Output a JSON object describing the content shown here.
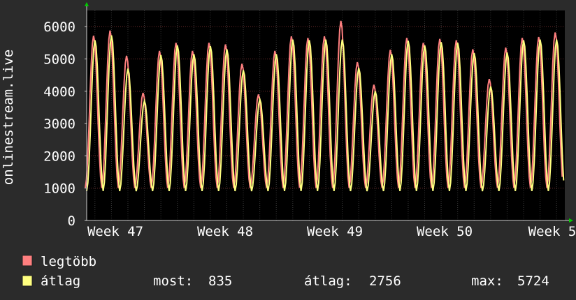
{
  "chart_data": {
    "type": "line",
    "ylabel": "onlinestream.live",
    "ylim": [
      0,
      6500
    ],
    "y_ticks": [
      "0",
      "1000",
      "2000",
      "3000",
      "4000",
      "5000",
      "6000"
    ],
    "x_ticks": [
      "Week 47",
      "Week 48",
      "Week 49",
      "Week 50",
      "Week 5"
    ],
    "colors": {
      "max": "#ff7f7f",
      "avg": "#ffff80",
      "bg": "#000000",
      "grid": "#5a2a2a"
    },
    "daily_peaks": {
      "max": [
        5720,
        5880,
        5100,
        3950,
        5250,
        5500,
        5250,
        5500,
        5450,
        4850,
        3900,
        5250,
        5700,
        5650,
        5700,
        6180,
        4900,
        4200,
        5280,
        5650,
        5500,
        5620,
        5580,
        5300,
        4380,
        5350,
        5650,
        5680,
        5820
      ],
      "avg": [
        5580,
        5730,
        4700,
        3700,
        5120,
        5420,
        5150,
        5400,
        5300,
        4650,
        3750,
        5150,
        5600,
        5580,
        5600,
        5600,
        4720,
        4000,
        5150,
        5560,
        5420,
        5520,
        5500,
        5180,
        4150,
        5200,
        5580,
        5600,
        5600
      ]
    },
    "series": [
      {
        "name": "legtöbb",
        "color": "#ff7f7f"
      },
      {
        "name": "átlag",
        "color": "#ffff80"
      }
    ],
    "stats": {
      "most_label": "most:",
      "most_value": "835",
      "avg_label": "átlag:",
      "avg_value": "2756",
      "max_label": "max:",
      "max_value": "5724"
    }
  }
}
